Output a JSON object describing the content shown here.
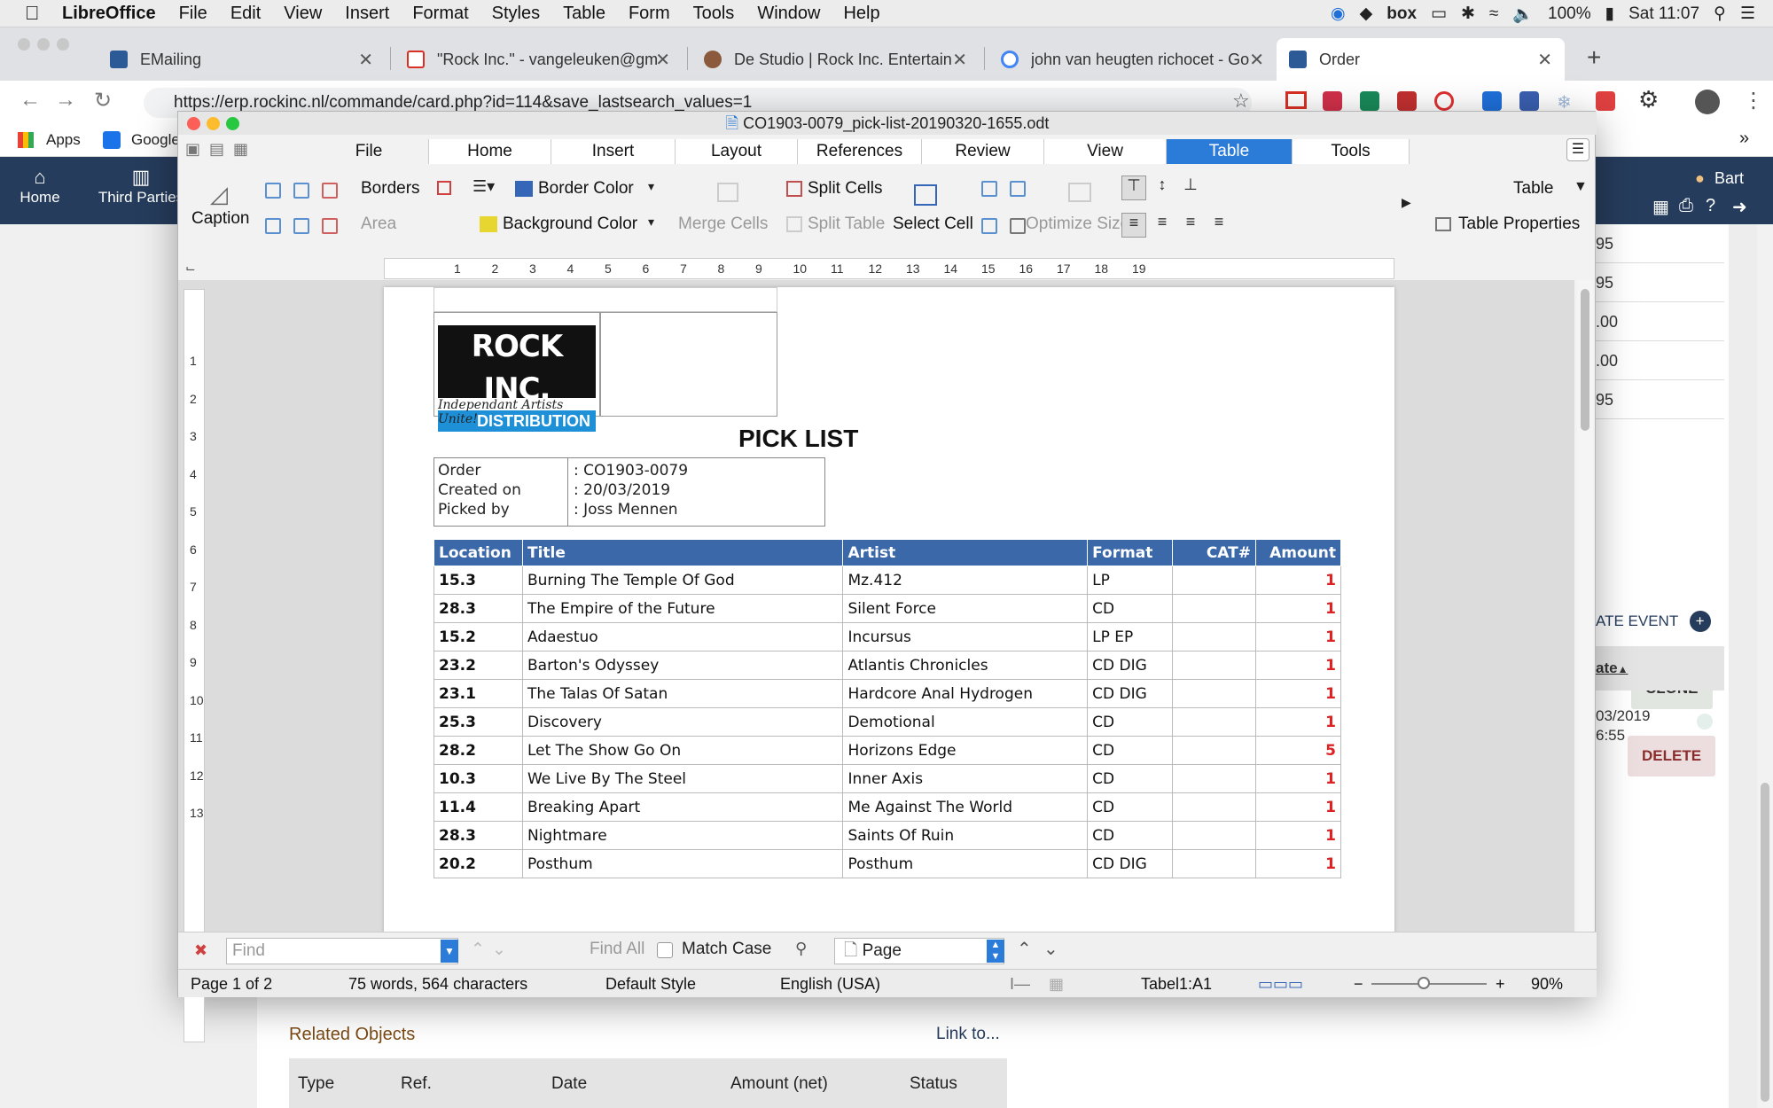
{
  "macmenu": {
    "app": "LibreOffice",
    "items": [
      "File",
      "Edit",
      "View",
      "Insert",
      "Format",
      "Styles",
      "Table",
      "Form",
      "Tools",
      "Window",
      "Help"
    ],
    "battery": "100%",
    "clock": "Sat 11:07",
    "box": "box"
  },
  "browser": {
    "tabs": [
      {
        "title": "EMailing"
      },
      {
        "title": "\"Rock Inc.\" - vangeleuken@gm"
      },
      {
        "title": "De Studio | Rock Inc. Entertain"
      },
      {
        "title": "john van heugten richocet - Go"
      },
      {
        "title": "Order"
      }
    ],
    "url": "https://erp.rockinc.nl/commande/card.php?id=114&save_lastsearch_values=1",
    "bookmarks": [
      "Apps",
      "Google"
    ]
  },
  "web": {
    "nav": [
      "Home",
      "Third Parties"
    ],
    "user": "Bart",
    "right_values": [
      "95",
      "95",
      ".00",
      ".00",
      "95"
    ],
    "clone": "CLONE",
    "delete": "DELETE",
    "event": "ATE EVENT",
    "date_col": "ate",
    "date_val1": "03/2019",
    "date_val2": "6:55",
    "related_title": "Related Objects",
    "link_to": "Link to...",
    "related_cols": [
      "Type",
      "Ref.",
      "Date",
      "Amount (net)",
      "Status"
    ]
  },
  "writer": {
    "title": "CO1903-0079_pick-list-20190320-1655.odt",
    "tabs": [
      "File",
      "Home",
      "Insert",
      "Layout",
      "References",
      "Review",
      "View",
      "Table",
      "Tools"
    ],
    "ribbon": {
      "caption": "Caption",
      "borders": "Borders",
      "border_color": "Border Color",
      "area": "Area",
      "background_color": "Background Color",
      "merge_cells": "Merge Cells",
      "split_cells": "Split Cells",
      "split_table": "Split Table",
      "select_cell": "Select Cell",
      "optimize_size": "Optimize Size",
      "table": "Table",
      "table_properties": "Table Properties"
    },
    "hruler": [
      "1",
      "2",
      "3",
      "4",
      "5",
      "6",
      "7",
      "8",
      "9",
      "10",
      "11",
      "12",
      "13",
      "14",
      "15",
      "16",
      "17",
      "18",
      "19"
    ],
    "vruler": [
      "1",
      "2",
      "3",
      "4",
      "5",
      "6",
      "7",
      "8",
      "9",
      "10",
      "11",
      "12",
      "13"
    ],
    "logo": {
      "line1": "ROCK INC.",
      "line2": "DISTRIBUTION",
      "line3": "Independant Artists Unite!"
    },
    "pick_title": "PICK LIST",
    "info": [
      {
        "label": "Order",
        "value": ": CO1903-0079"
      },
      {
        "label": "Created on",
        "value": ": 20/03/2019"
      },
      {
        "label": "Picked by",
        "value": ": Joss Mennen"
      }
    ],
    "columns": [
      "Location",
      "Title",
      "Artist",
      "Format",
      "CAT#",
      "Amount"
    ],
    "rows": [
      [
        "15.3",
        "Burning The Temple Of God",
        "Mz.412",
        "LP",
        "",
        "1"
      ],
      [
        "28.3",
        "The Empire of the Future",
        "Silent Force",
        "CD",
        "",
        "1"
      ],
      [
        "15.2",
        "Adaestuo",
        "Incursus",
        "LP EP",
        "",
        "1"
      ],
      [
        "23.2",
        "Barton's Odyssey",
        "Atlantis Chronicles",
        "CD DIG",
        "",
        "1"
      ],
      [
        "23.1",
        "The Talas Of Satan",
        "Hardcore Anal Hydrogen",
        "CD DIG",
        "",
        "1"
      ],
      [
        "25.3",
        "Discovery",
        "Demotional",
        "CD",
        "",
        "1"
      ],
      [
        "28.2",
        "Let The Show Go On",
        "Horizons Edge",
        "CD",
        "",
        "5"
      ],
      [
        "10.3",
        "We Live By The Steel",
        "Inner Axis",
        "CD",
        "",
        "1"
      ],
      [
        "11.4",
        "Breaking Apart",
        "Me Against The World",
        "CD",
        "",
        "1"
      ],
      [
        "28.3",
        "Nightmare",
        "Saints Of Ruin",
        "CD",
        "",
        "1"
      ],
      [
        "20.2",
        "Posthum",
        "Posthum",
        "CD DIG",
        "",
        "1"
      ]
    ],
    "find": {
      "placeholder": "Find",
      "find_all": "Find All",
      "match_case": "Match Case",
      "page": "Page"
    },
    "status": {
      "page": "Page 1 of 2",
      "words": "75 words, 564 characters",
      "style": "Default Style",
      "lang": "English (USA)",
      "cell": "Tabel1:A1",
      "zoom": "90%"
    }
  }
}
